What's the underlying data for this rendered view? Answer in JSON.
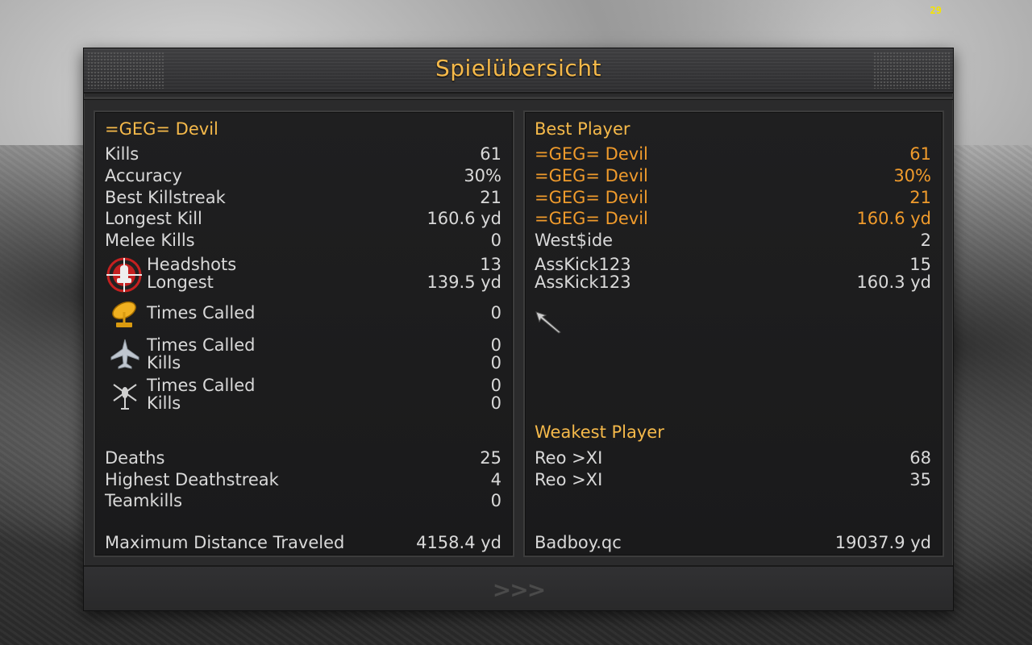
{
  "fps": "29",
  "title": "Spielübersicht",
  "left_panel": {
    "player": "=GEG= Devil",
    "kills": {
      "label": "Kills",
      "value": "61"
    },
    "accuracy": {
      "label": "Accuracy",
      "value": "30%"
    },
    "best_killstreak": {
      "label": "Best Killstreak",
      "value": "21"
    },
    "longest_kill": {
      "label": "Longest Kill",
      "value": "160.6 yd"
    },
    "melee_kills": {
      "label": "Melee Kills",
      "value": "0"
    },
    "headshots": {
      "label": "Headshots",
      "value": "13",
      "longest_label": "Longest",
      "longest_value": "139.5 yd",
      "icon": "headshot-crosshair-icon"
    },
    "uav": {
      "label": "Times Called",
      "value": "0",
      "icon": "radar-dish-icon"
    },
    "airstrike": {
      "label": "Times Called",
      "value": "0",
      "kills_label": "Kills",
      "kills_value": "0",
      "icon": "jet-icon"
    },
    "helicopter": {
      "label": "Times Called",
      "value": "0",
      "kills_label": "Kills",
      "kills_value": "0",
      "icon": "helicopter-icon"
    },
    "deaths": {
      "label": "Deaths",
      "value": "25"
    },
    "highest_deathstreak": {
      "label": "Highest Deathstreak",
      "value": "4"
    },
    "teamkills": {
      "label": "Teamkills",
      "value": "0"
    },
    "max_distance": {
      "label": "Maximum Distance Traveled",
      "value": "4158.4 yd"
    }
  },
  "right_panel": {
    "best_title": "Best Player",
    "best_rows": [
      {
        "name": "=GEG= Devil",
        "value": "61"
      },
      {
        "name": "=GEG= Devil",
        "value": "30%"
      },
      {
        "name": "=GEG= Devil",
        "value": "21"
      },
      {
        "name": "=GEG= Devil",
        "value": "160.6 yd"
      },
      {
        "name": "West$ide",
        "value": "2"
      },
      {
        "name": "AssKick123",
        "value": "15"
      },
      {
        "name": "AssKick123",
        "value": "160.3 yd"
      }
    ],
    "weakest_title": "Weakest Player",
    "weakest_rows": [
      {
        "name": "Reo >XI",
        "value": "68"
      },
      {
        "name": "Reo >XI",
        "value": "35"
      }
    ],
    "distance_row": {
      "name": "Badboy.qc",
      "value": "19037.9 yd"
    }
  },
  "footer": {
    "next_label": ">>>"
  },
  "colors": {
    "accent": "#f5b94a",
    "highlight": "#f09b2c",
    "text": "#d9d9d9"
  }
}
